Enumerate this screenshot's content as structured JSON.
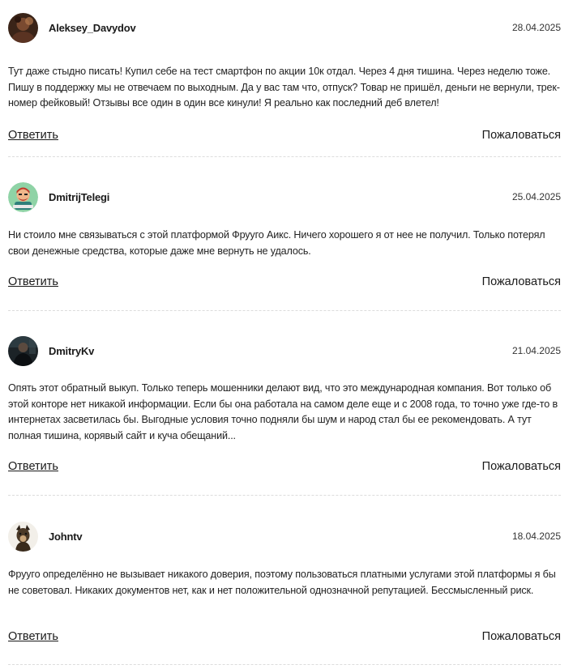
{
  "comments": [
    {
      "username": "Aleksey_Davydov",
      "avatar": "user-photo-brown",
      "date": "28.04.2025",
      "text": "Тут даже стыдно писать! Купил себе на тест смартфон по акции 10к отдал. Через 4 дня тишина. Через неделю тоже. Пишу в поддержку мы не отвечаем по выходным. Да у вас там что, отпуск? Товар не пришёл, деньги не вернули, трек-номер фейковый! Отзывы все один в один все кинули! Я реально как последний деб влетел!",
      "reply_label": "Ответить",
      "report_label": "Пожаловаться"
    },
    {
      "username": "DmitrijTelegi",
      "avatar": "user-cartoon-green",
      "date": "25.04.2025",
      "text": "Ни стоило мне связываться с этой платформой Фрууго Аикс. Ничего хорошего я от нее не получил. Только потерял свои денежные средства, которые даже мне вернуть не удалось.",
      "reply_label": "Ответить",
      "report_label": "Пожаловаться"
    },
    {
      "username": "DmitryKv",
      "avatar": "user-photo-dark",
      "date": "21.04.2025",
      "text": "Опять этот обратный выкуп. Только теперь мошенники делают вид, что это международная компания. Вот только об этой конторе нет никакой информации. Если бы она работала на самом деле еще и с 2008 года, то точно уже где-то в интернетах засветилась бы. Выгодные условия точно подняли бы шум и народ стал бы ее рекомендовать. А тут полная тишина, корявый сайт и куча обещаний...",
      "reply_label": "Ответить",
      "report_label": "Пожаловаться"
    },
    {
      "username": "Johntv",
      "avatar": "user-photo-dog",
      "date": "18.04.2025",
      "text": "Фрууго определённо не вызывает никакого доверия, поэтому пользоваться платными услугами этой платформы я бы не советовал. Никаких документов нет, как и нет положительной однозначной репутацией. Бессмысленный риск.",
      "reply_label": "Ответить",
      "report_label": "Пожаловаться"
    }
  ]
}
